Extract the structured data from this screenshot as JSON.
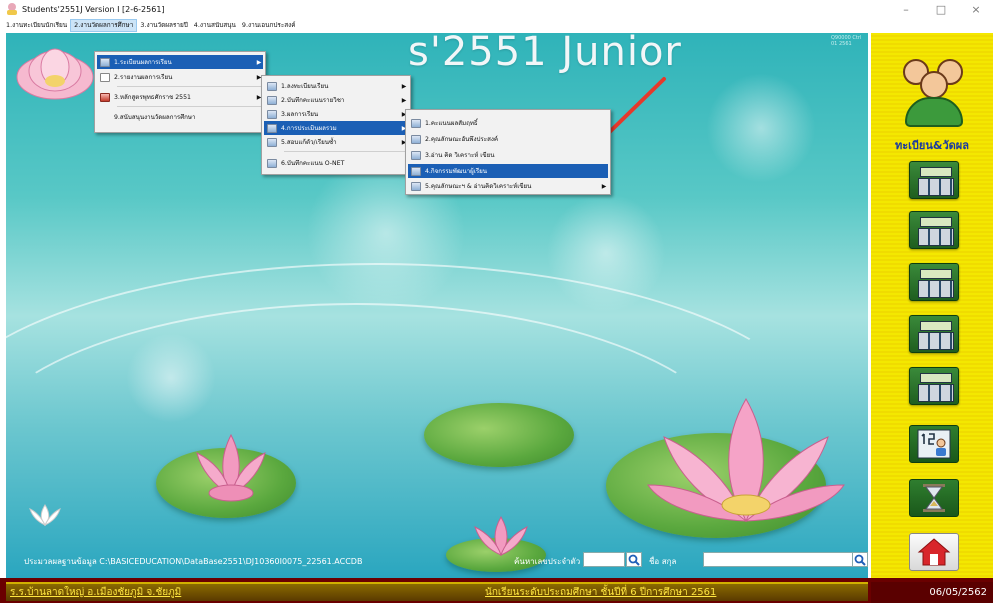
{
  "window": {
    "title": "Students'2551J Version I [2-6-2561]",
    "minimize": "–",
    "maximize": "□",
    "close": "×"
  },
  "menubar": [
    "1.งานทะเบียนนักเรียน",
    "2.งานวัดผลการศึกษา",
    "3.งานวัดผลรายปี",
    "4.งานสนับสนุน",
    "9.งานเอนกประสงค์"
  ],
  "banner": {
    "title": "s'2551 Junior",
    "watermark": "Q90000 Ctrl 01 2561"
  },
  "menu1": [
    {
      "label": "1.ระเบียนผลการเรียน",
      "arrow": "▶"
    },
    {
      "label": "2.รายงานผลการเรียน",
      "arrow": "▶"
    },
    {
      "label": "3.หลักสูตรพุทธศักราช 2551",
      "arrow": "▶"
    },
    {
      "label": "9.สนับสนุนงานวัดผลการศึกษา",
      "arrow": ""
    }
  ],
  "menu2": [
    {
      "label": "1.ลงทะเบียนเรียน",
      "arrow": "▶"
    },
    {
      "label": "2.บันทึกคะแนนรายวิชา",
      "arrow": "▶"
    },
    {
      "label": "3.ผลการเรียน",
      "arrow": "▶"
    },
    {
      "label": "4.การประเมินผลรวม",
      "arrow": "▶"
    },
    {
      "label": "5.สอบแก้ตัว/เรียนซ้ำ",
      "arrow": "▶"
    },
    {
      "label": "6.บันทึกคะแนน O-NET",
      "arrow": ""
    }
  ],
  "menu3": [
    {
      "label": "1.คะแนนผลสัมฤทธิ์",
      "arrow": ""
    },
    {
      "label": "2.คุณลักษณะอันพึงประสงค์",
      "arrow": ""
    },
    {
      "label": "3.อ่าน คิด วิเคราะห์ เขียน",
      "arrow": ""
    },
    {
      "label": "4.กิจกรรมพัฒนาผู้เรียน",
      "arrow": ""
    },
    {
      "label": "5.คุณลักษณะฯ & อ่านคิดวิเคราะห์เขียน",
      "arrow": "▶"
    }
  ],
  "sidebar": {
    "heading": "ทะเบียน&วัดผล"
  },
  "search": {
    "path": "ประมวลผลฐานข้อมูล C:\\BASICEDUCATION\\DataBase2551\\DJ10360I0075_22561.ACCDB",
    "id_label": "ค้นหาเลขประจำตัว",
    "name_label": "ชื่อ สกุล"
  },
  "status": {
    "school": "ร.ร.บ้านลาดใหญ่ อ.เมืองชัยภูมิ จ.ชัยภูมิ",
    "level": "นักเรียนระดับประถมศึกษา ชั้นปีที่ 6 ปีการศึกษา 2561",
    "date": "06/05/2562"
  },
  "colors": {
    "highlight": "#1b5fb5",
    "arrow": "#e5392b",
    "status_text": "#ffe640"
  },
  "icons": [
    "app-icon",
    "users-icon",
    "calculator-icon",
    "number-person-icon",
    "hourglass-icon",
    "home-icon",
    "search-icon"
  ]
}
